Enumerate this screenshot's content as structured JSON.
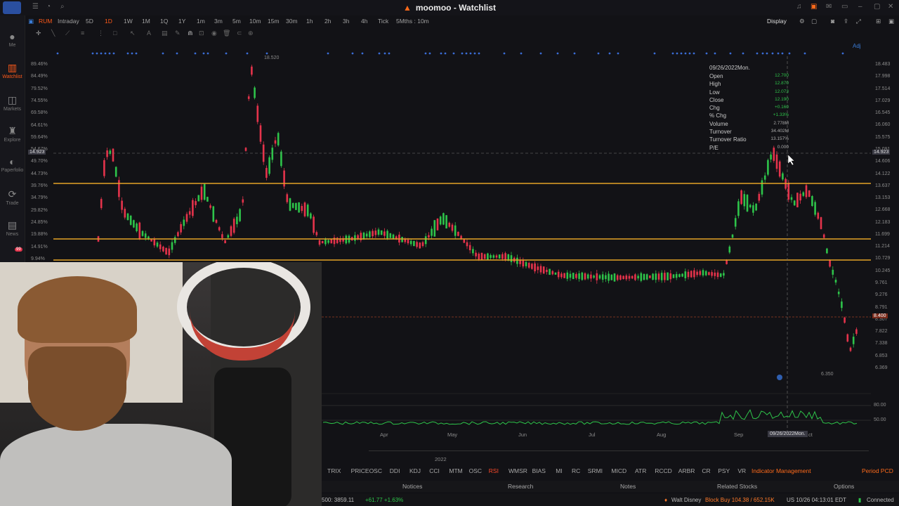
{
  "window": {
    "title": "moomoo - Watchlist"
  },
  "sidebar": {
    "items": [
      {
        "label": "Me",
        "icon": "user-icon"
      },
      {
        "label": "Watchlist",
        "icon": "watchlist-icon"
      },
      {
        "label": "Markets",
        "icon": "markets-icon"
      },
      {
        "label": "Explore",
        "icon": "explore-icon"
      },
      {
        "label": "Paperfolio",
        "icon": "paperfolio-icon"
      },
      {
        "label": "Trade",
        "icon": "trade-icon"
      },
      {
        "label": "News",
        "icon": "news-icon"
      }
    ],
    "badge": "99"
  },
  "toolbar": {
    "symbol": "RUM",
    "timeframes": [
      "Intraday",
      "5D",
      "1D",
      "1W",
      "1M",
      "1Q",
      "1Y",
      "1m",
      "3m",
      "5m",
      "10m",
      "15m",
      "30m",
      "1h",
      "2h",
      "3h",
      "4h",
      "Tick",
      "5Mths : 10m"
    ],
    "active_timeframe": "1D",
    "display_label": "Display"
  },
  "chart": {
    "adj_label": "Adj",
    "max_label": "18.520",
    "min_label": "6.350",
    "left_axis": [
      "89.46%",
      "84.49%",
      "79.52%",
      "74.55%",
      "69.58%",
      "64.61%",
      "59.64%",
      "54.67%",
      "49.70%",
      "44.73%",
      "39.76%",
      "34.79%",
      "29.82%",
      "24.85%",
      "19.88%",
      "14.91%",
      "9.94%"
    ],
    "right_axis": [
      "18.483",
      "17.998",
      "17.514",
      "17.029",
      "16.545",
      "16.060",
      "15.575",
      "15.091",
      "14.606",
      "14.122",
      "13.637",
      "13.153",
      "12.668",
      "12.183",
      "11.699",
      "11.214",
      "10.729",
      "10.245",
      "9.761",
      "9.276",
      "8.791",
      "8.307",
      "7.822",
      "7.338",
      "6.853",
      "6.369"
    ],
    "crosshair_left": "14.923",
    "crosshair_right": "14.923",
    "price_line_label": "8.400",
    "x_axis": [
      "Apr",
      "May",
      "Jun",
      "Jul",
      "Aug",
      "Sep"
    ],
    "x_year": "2022",
    "x_crosshair": "09/26/2022Mon.",
    "x_after": "ct",
    "rsi_axis": [
      "80.00",
      "50.00"
    ]
  },
  "tooltip": {
    "date": "09/26/2022Mon.",
    "rows": [
      {
        "k": "Open",
        "v": "12.700"
      },
      {
        "k": "High",
        "v": "12.870"
      },
      {
        "k": "Low",
        "v": "12.073"
      },
      {
        "k": "Close",
        "v": "12.190"
      },
      {
        "k": "Chg",
        "v": "+0.160"
      },
      {
        "k": "% Chg",
        "v": "+1.33%"
      },
      {
        "k": "Volume",
        "v": "2.778M"
      },
      {
        "k": "Turnover",
        "v": "34.402M"
      },
      {
        "k": "Turnover Ratio",
        "v": "13.157%"
      },
      {
        "k": "P/E",
        "v": "0.000"
      }
    ]
  },
  "indicators": [
    "TRIX",
    "PRICEOSC",
    "DDI",
    "KDJ",
    "CCI",
    "MTM",
    "OSC",
    "RSI",
    "WMSR",
    "BIAS",
    "MI",
    "RC",
    "SRMI",
    "MICD",
    "ATR",
    "RCCD",
    "ARBR",
    "CR",
    "PSY",
    "VR"
  ],
  "active_indicator": "RSI",
  "indicator_management": "Indicator Management",
  "period_label": "Period PCD",
  "bottom_tabs": [
    "Notices",
    "Research",
    "Notes",
    "Related Stocks",
    "Options"
  ],
  "status": {
    "index": "500: 3859.11",
    "index_chg": "+61.77 +1.63%",
    "ticker_msg": "Walt Disney",
    "ticker_trade": "Block Buy 104.38 / 652.15K",
    "market_time": "US 10/26 04:13:01 EDT",
    "connection": "Connected"
  },
  "colors": {
    "accent": "#ff5a1a",
    "up": "#2ec44a",
    "down": "#e5334b",
    "level": "#e5a326"
  }
}
